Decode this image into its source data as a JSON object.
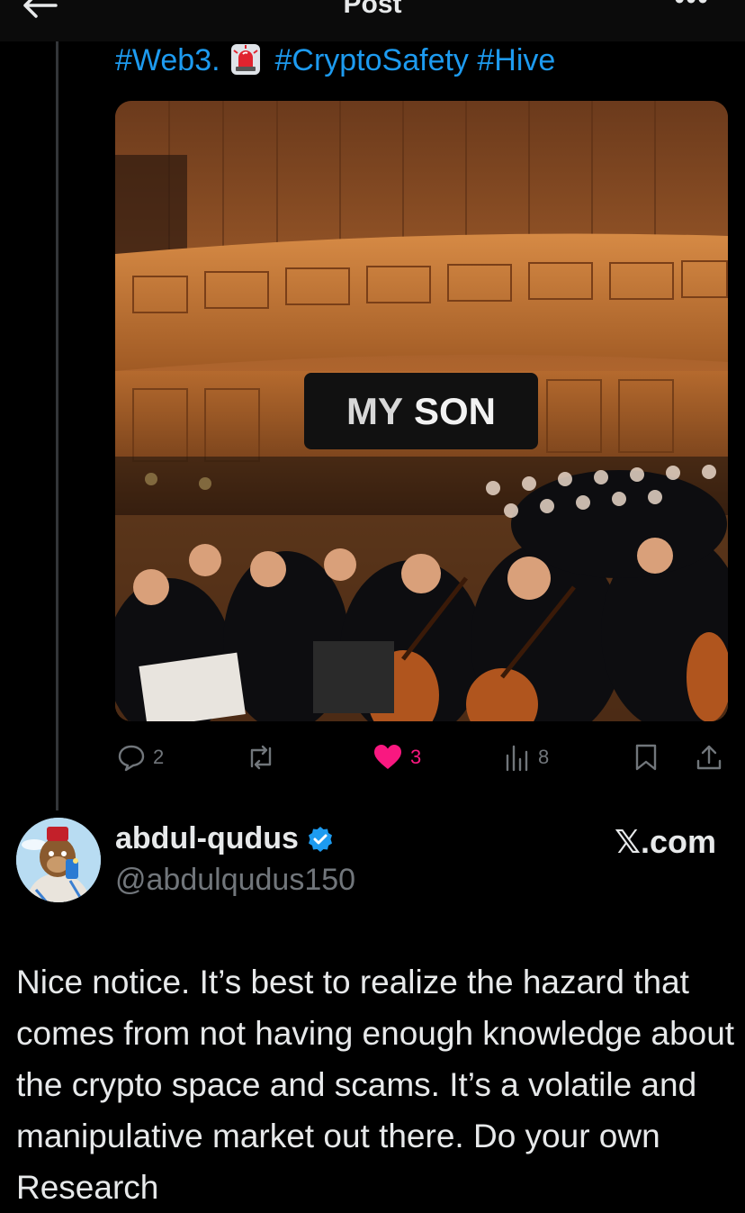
{
  "header": {
    "title": "Post",
    "back_icon": "arrow-left-icon",
    "more_icon": "more-dots-icon",
    "more_label": "•••"
  },
  "post": {
    "hashtag_web3": "#Web3",
    "hashtag_separator": ".",
    "siren_emoji": "🚨",
    "hashtag_crypto_safety": "#CryptoSafety",
    "hashtag_hive": "#Hive",
    "media": {
      "caption_word1": "MY",
      "caption_word2": "SON",
      "sound_icon": "speaker-on-icon"
    },
    "actions": {
      "replies": "2",
      "likes": "3",
      "views": "8"
    }
  },
  "reply": {
    "name": "abdul-qudus",
    "handle": "@abdulqudus150",
    "source": "𝕏.com",
    "text": "Nice notice. It’s best to realize the hazard that comes from not having enough knowledge about the crypto space and scams. It’s a volatile and manipulative market out there. Do your own Research"
  },
  "colors": {
    "background": "#000000",
    "accent": "#1d9bf0",
    "like": "#f91880",
    "muted": "#71767b",
    "text": "#e7e9ea"
  }
}
